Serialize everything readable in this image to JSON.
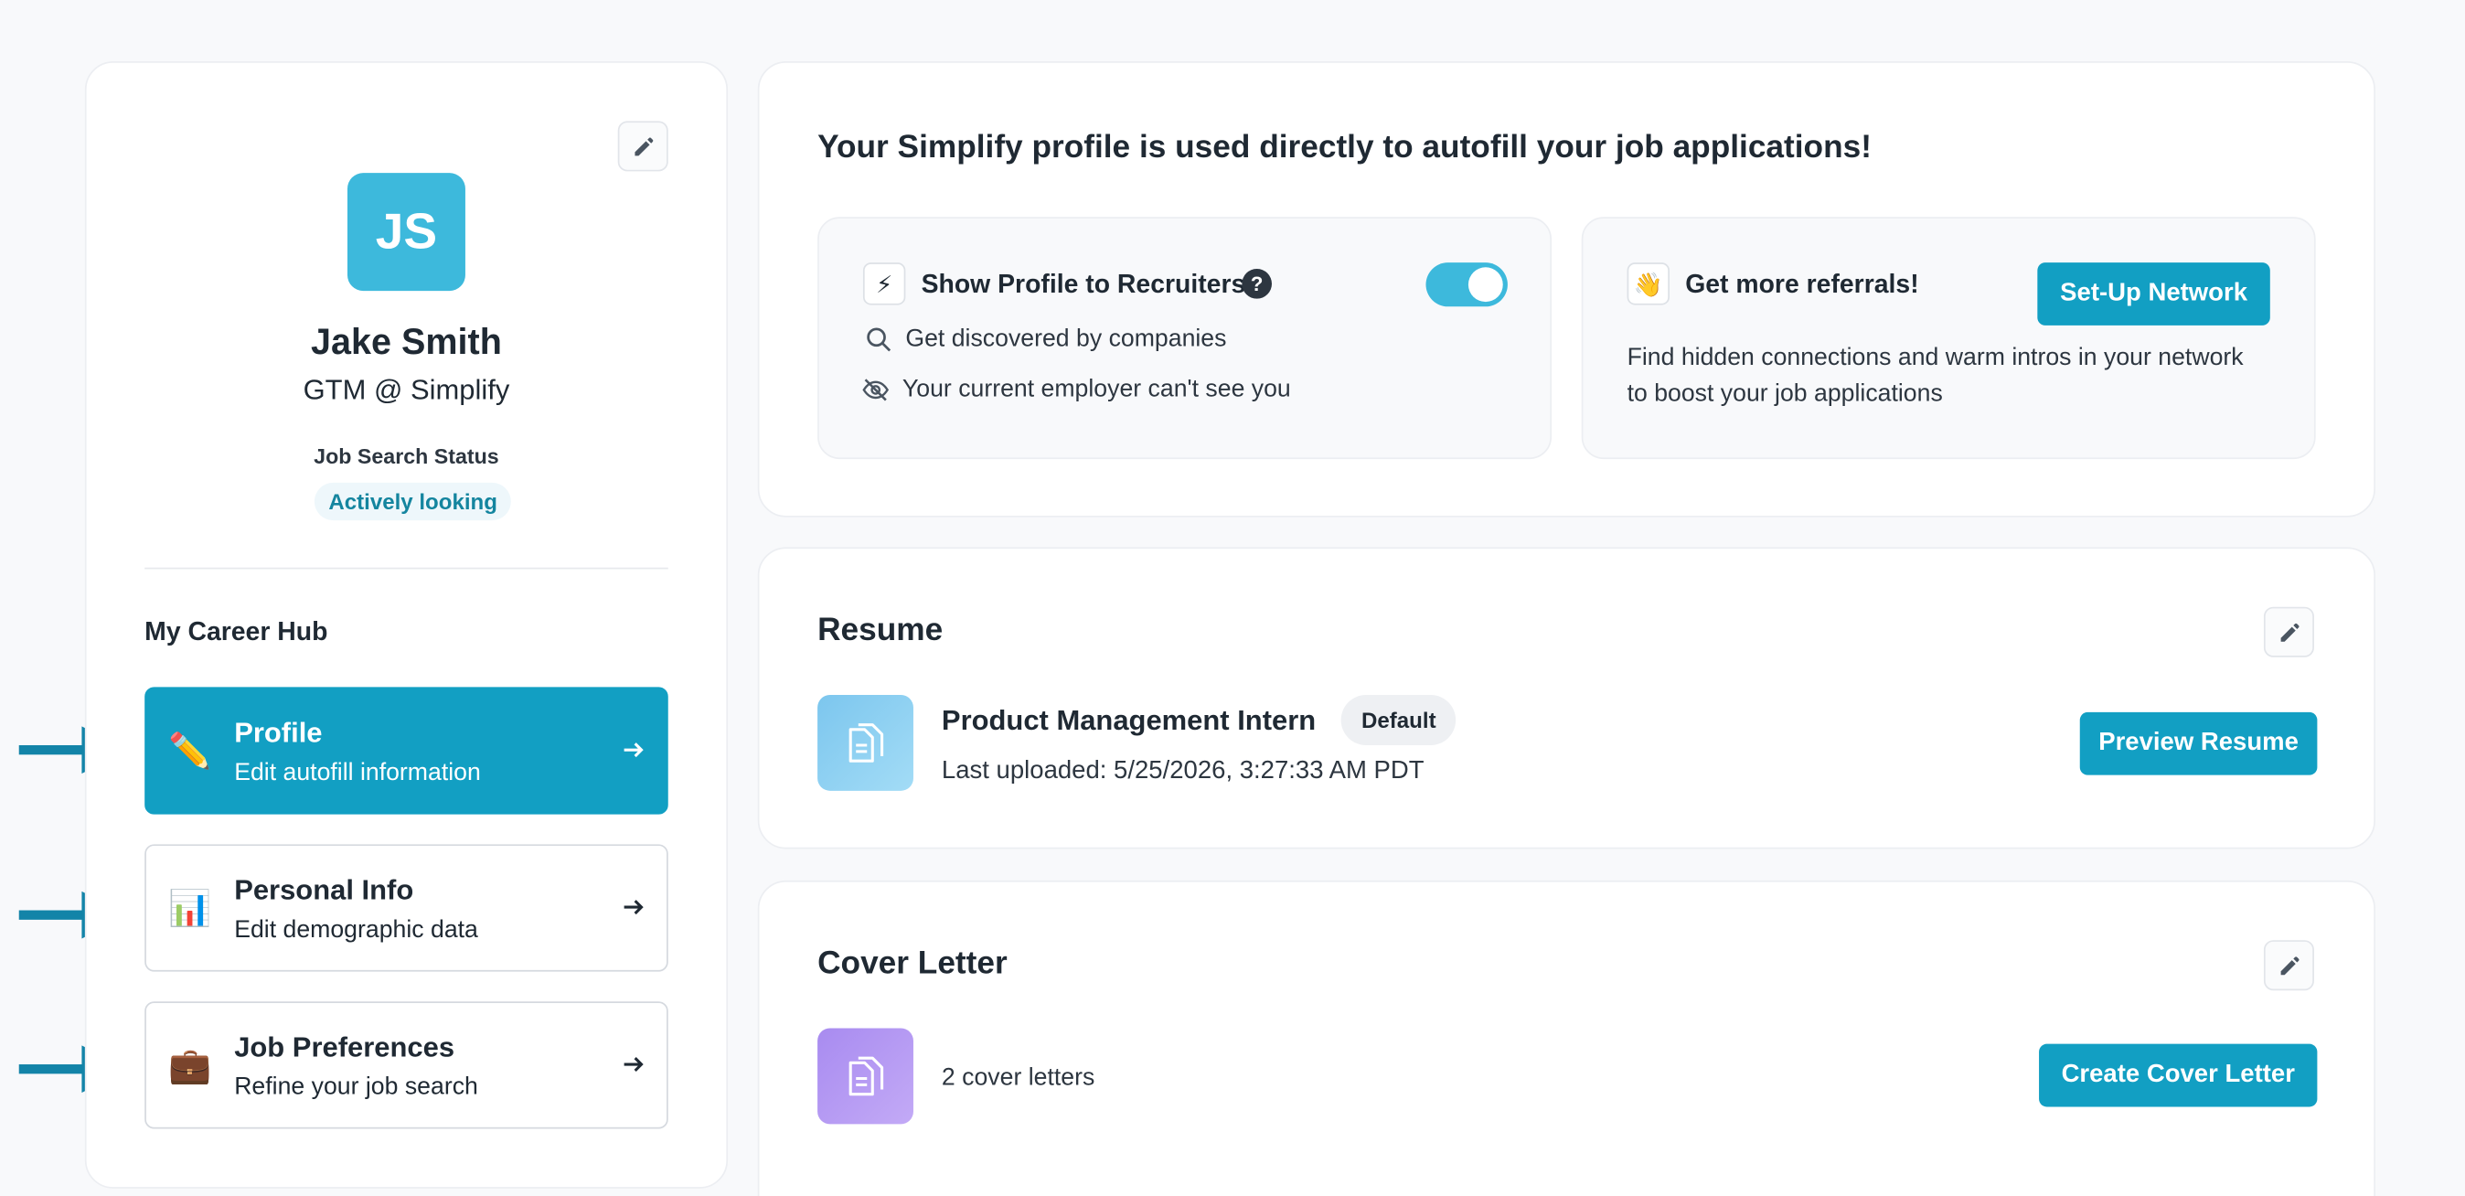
{
  "colors": {
    "accent": "#129fc3",
    "avatar_bg": "#3db9dc",
    "toggle_on": "#3db9dc",
    "pointer_arrow": "#1384a8"
  },
  "sidebar": {
    "edit_icon": "pencil-icon",
    "avatar_initials": "JS",
    "name": "Jake Smith",
    "title": "GTM @ Simplify",
    "job_search_status_label": "Job Search Status",
    "job_search_status": "Actively looking",
    "career_hub_heading": "My Career Hub",
    "items": [
      {
        "icon": "pencil-emoji",
        "emoji": "✏️",
        "title": "Profile",
        "subtitle": "Edit autofill information",
        "active": true
      },
      {
        "icon": "bar-chart-emoji",
        "emoji": "📊",
        "title": "Personal Info",
        "subtitle": "Edit demographic data",
        "active": false
      },
      {
        "icon": "briefcase-emoji",
        "emoji": "💼",
        "title": "Job Preferences",
        "subtitle": "Refine your job search",
        "active": false
      }
    ]
  },
  "autofill": {
    "heading": "Your Simplify profile is used directly to autofill your job applications!",
    "recruiters": {
      "emoji": "⚡",
      "title": "Show Profile to Recruiters",
      "help": "?",
      "toggle_on": true,
      "bullets": [
        {
          "icon": "search-icon",
          "text": "Get discovered by companies"
        },
        {
          "icon": "eye-off-icon",
          "text": "Your current employer can't see you"
        }
      ]
    },
    "referrals": {
      "emoji": "👋",
      "title": "Get more referrals!",
      "button": "Set-Up Network",
      "description": "Find hidden connections and warm intros in your network to boost your job applications"
    }
  },
  "resume": {
    "title": "Resume",
    "file_name": "Product Management Intern",
    "badge": "Default",
    "uploaded": "Last uploaded: 5/25/2026, 3:27:33 AM PDT",
    "button": "Preview Resume"
  },
  "cover_letter": {
    "title": "Cover Letter",
    "count": "2 cover letters",
    "button": "Create Cover Letter"
  }
}
